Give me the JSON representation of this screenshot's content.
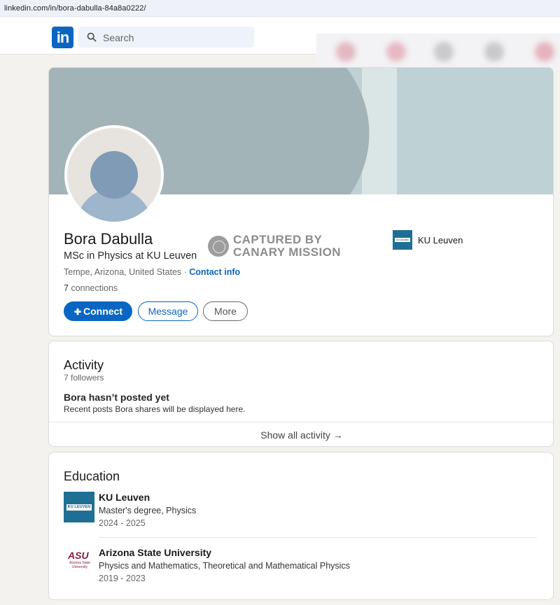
{
  "browser": {
    "url": "linkedin.com/in/bora-dabulla-84a8a0222/"
  },
  "nav": {
    "logo_text": "in",
    "search_placeholder": "Search"
  },
  "profile": {
    "name": "Bora Dabulla",
    "headline": "MSc in Physics at KU Leuven",
    "location": "Tempe, Arizona, United States",
    "location_sep": " · ",
    "contact_label": "Contact info",
    "connections_count": "7",
    "connections_label": "connections",
    "buttons": {
      "connect": "Connect",
      "message": "Message",
      "more": "More"
    },
    "current_school": "KU Leuven",
    "current_school_logo_text": "KU LEUVEN"
  },
  "stamp": {
    "line1": "CAPTURED BY",
    "line2": "CANARY MISSION"
  },
  "activity": {
    "title": "Activity",
    "followers": "7 followers",
    "empty_title": "Bora hasn’t posted yet",
    "empty_desc": "Recent posts Bora shares will be displayed here.",
    "show_all": "Show all activity",
    "arrow": "→"
  },
  "education": {
    "title": "Education",
    "items": [
      {
        "school": "KU Leuven",
        "degree": "Master's degree, Physics",
        "dates": "2024 - 2025",
        "logo_text": "KU LEUVEN"
      },
      {
        "school": "Arizona State University",
        "degree": "Physics and Mathematics, Theoretical and Mathematical Physics",
        "dates": "2019 - 2023",
        "logo_text": "ASU",
        "logo_sub": "Arizona State University"
      }
    ]
  },
  "colors": {
    "brand": "#0a66c2",
    "cover": "#bed1d4",
    "asu": "#8c1d40",
    "ku": "#1f6f94"
  }
}
